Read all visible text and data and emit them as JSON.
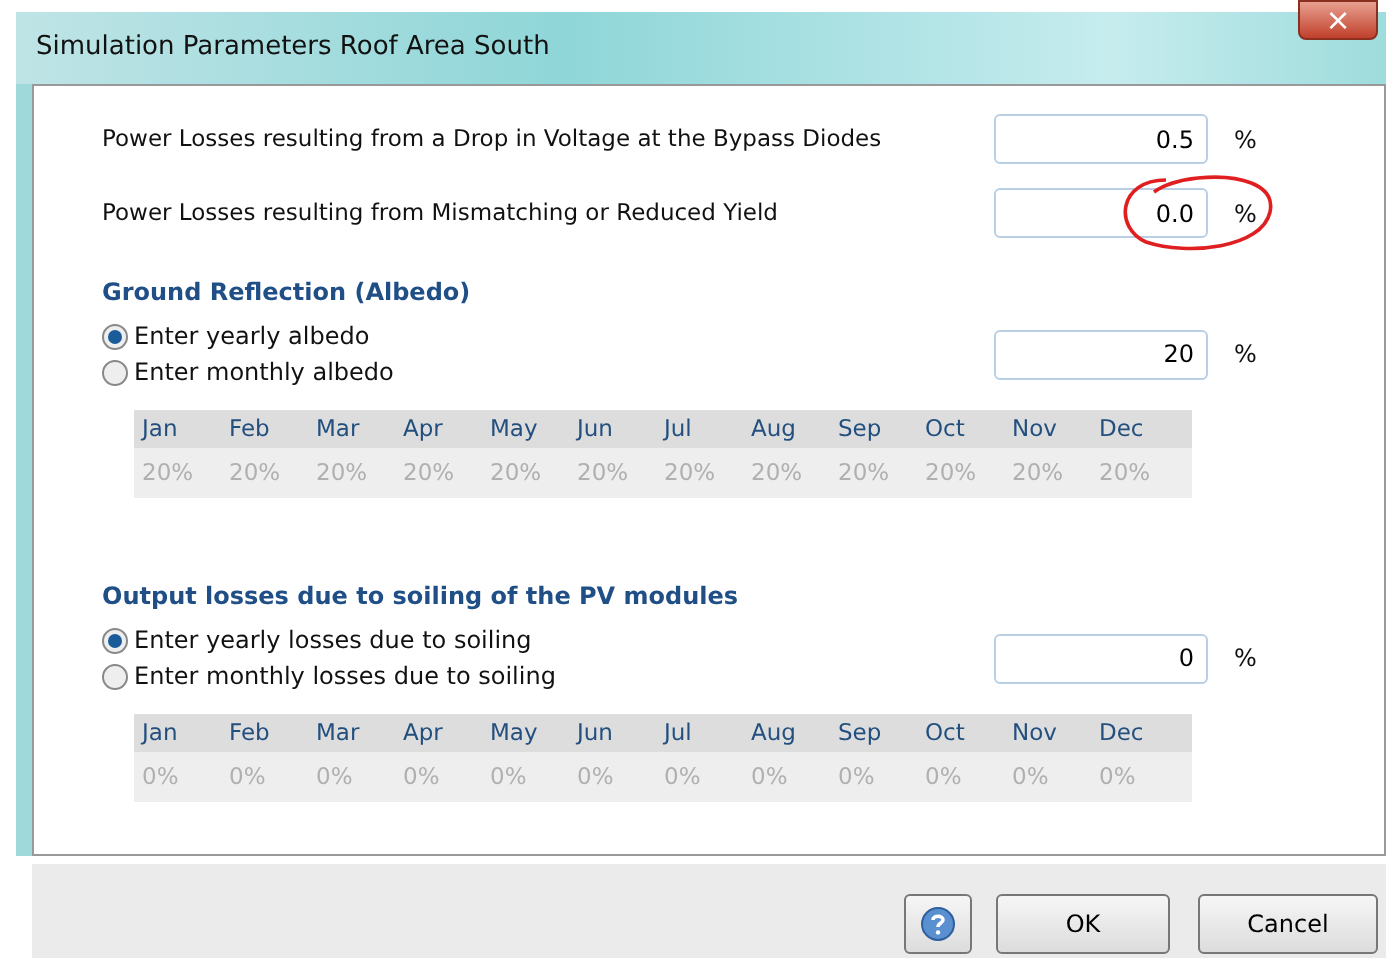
{
  "window": {
    "title": "Simulation Parameters Roof Area South",
    "close_label": "×"
  },
  "losses": [
    {
      "label": "Power Losses resulting from a Drop in Voltage at the Bypass Diodes",
      "value": "0.5",
      "unit": "%",
      "annotated": false
    },
    {
      "label": "Power Losses resulting from Mismatching or Reduced Yield",
      "value": "0.0",
      "unit": "%",
      "annotated": true
    }
  ],
  "sections": [
    {
      "heading": "Ground Reflection (Albedo)",
      "options": [
        {
          "label": "Enter yearly albedo",
          "selected": true
        },
        {
          "label": "Enter monthly albedo",
          "selected": false
        }
      ],
      "value": "20",
      "unit": "%",
      "months": [
        "Jan",
        "Feb",
        "Mar",
        "Apr",
        "May",
        "Jun",
        "Jul",
        "Aug",
        "Sep",
        "Oct",
        "Nov",
        "Dec"
      ],
      "monthly_values": [
        "20%",
        "20%",
        "20%",
        "20%",
        "20%",
        "20%",
        "20%",
        "20%",
        "20%",
        "20%",
        "20%",
        "20%"
      ]
    },
    {
      "heading": "Output losses due to soiling of the PV modules",
      "options": [
        {
          "label": "Enter yearly losses due to soiling",
          "selected": true
        },
        {
          "label": "Enter monthly losses due to soiling",
          "selected": false
        }
      ],
      "value": "0",
      "unit": "%",
      "months": [
        "Jan",
        "Feb",
        "Mar",
        "Apr",
        "May",
        "Jun",
        "Jul",
        "Aug",
        "Sep",
        "Oct",
        "Nov",
        "Dec"
      ],
      "monthly_values": [
        "0%",
        "0%",
        "0%",
        "0%",
        "0%",
        "0%",
        "0%",
        "0%",
        "0%",
        "0%",
        "0%",
        "0%"
      ]
    }
  ],
  "buttons": [
    "OK",
    "Cancel"
  ]
}
